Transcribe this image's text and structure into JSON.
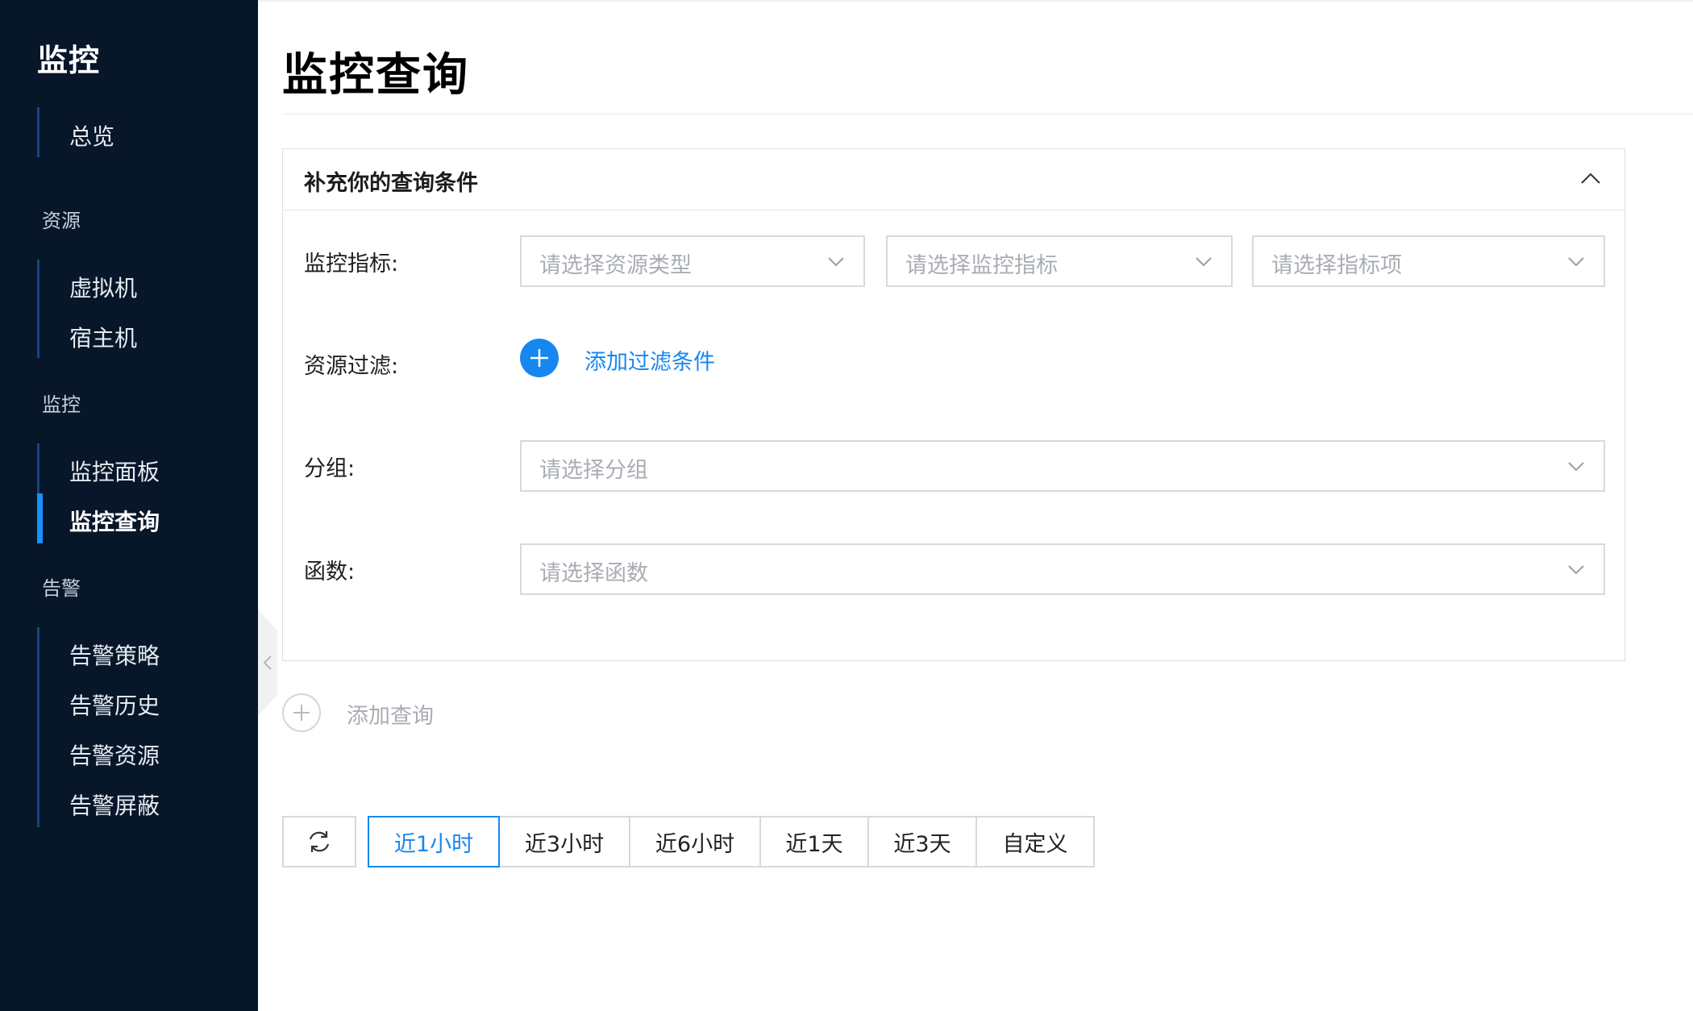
{
  "sidebar": {
    "brand": "监控",
    "overview": "总览",
    "sections": [
      {
        "label": "资源",
        "items": [
          "虚拟机",
          "宿主机"
        ]
      },
      {
        "label": "监控",
        "items": [
          "监控面板",
          "监控查询"
        ]
      },
      {
        "label": "告警",
        "items": [
          "告警策略",
          "告警历史",
          "告警资源",
          "告警屏蔽"
        ]
      }
    ],
    "active_item": "监控查询"
  },
  "page": {
    "title": "监控查询"
  },
  "query_panel": {
    "title": "补充你的查询条件",
    "metric": {
      "label": "监控指标:",
      "resource_type_placeholder": "请选择资源类型",
      "metric_placeholder": "请选择监控指标",
      "metric_item_placeholder": "请选择指标项"
    },
    "filter": {
      "label": "资源过滤:",
      "add_label": "添加过滤条件"
    },
    "group": {
      "label": "分组:",
      "placeholder": "请选择分组"
    },
    "function": {
      "label": "函数:",
      "placeholder": "请选择函数"
    }
  },
  "add_query": {
    "label": "添加查询"
  },
  "time_range": {
    "options": [
      "近1小时",
      "近3小时",
      "近6小时",
      "近1天",
      "近3天",
      "自定义"
    ],
    "selected": "近1小时"
  },
  "colors": {
    "sidebar_bg": "#071629",
    "accent": "#1787f0",
    "border": "#d6d9dd",
    "placeholder": "#a9adb3"
  }
}
